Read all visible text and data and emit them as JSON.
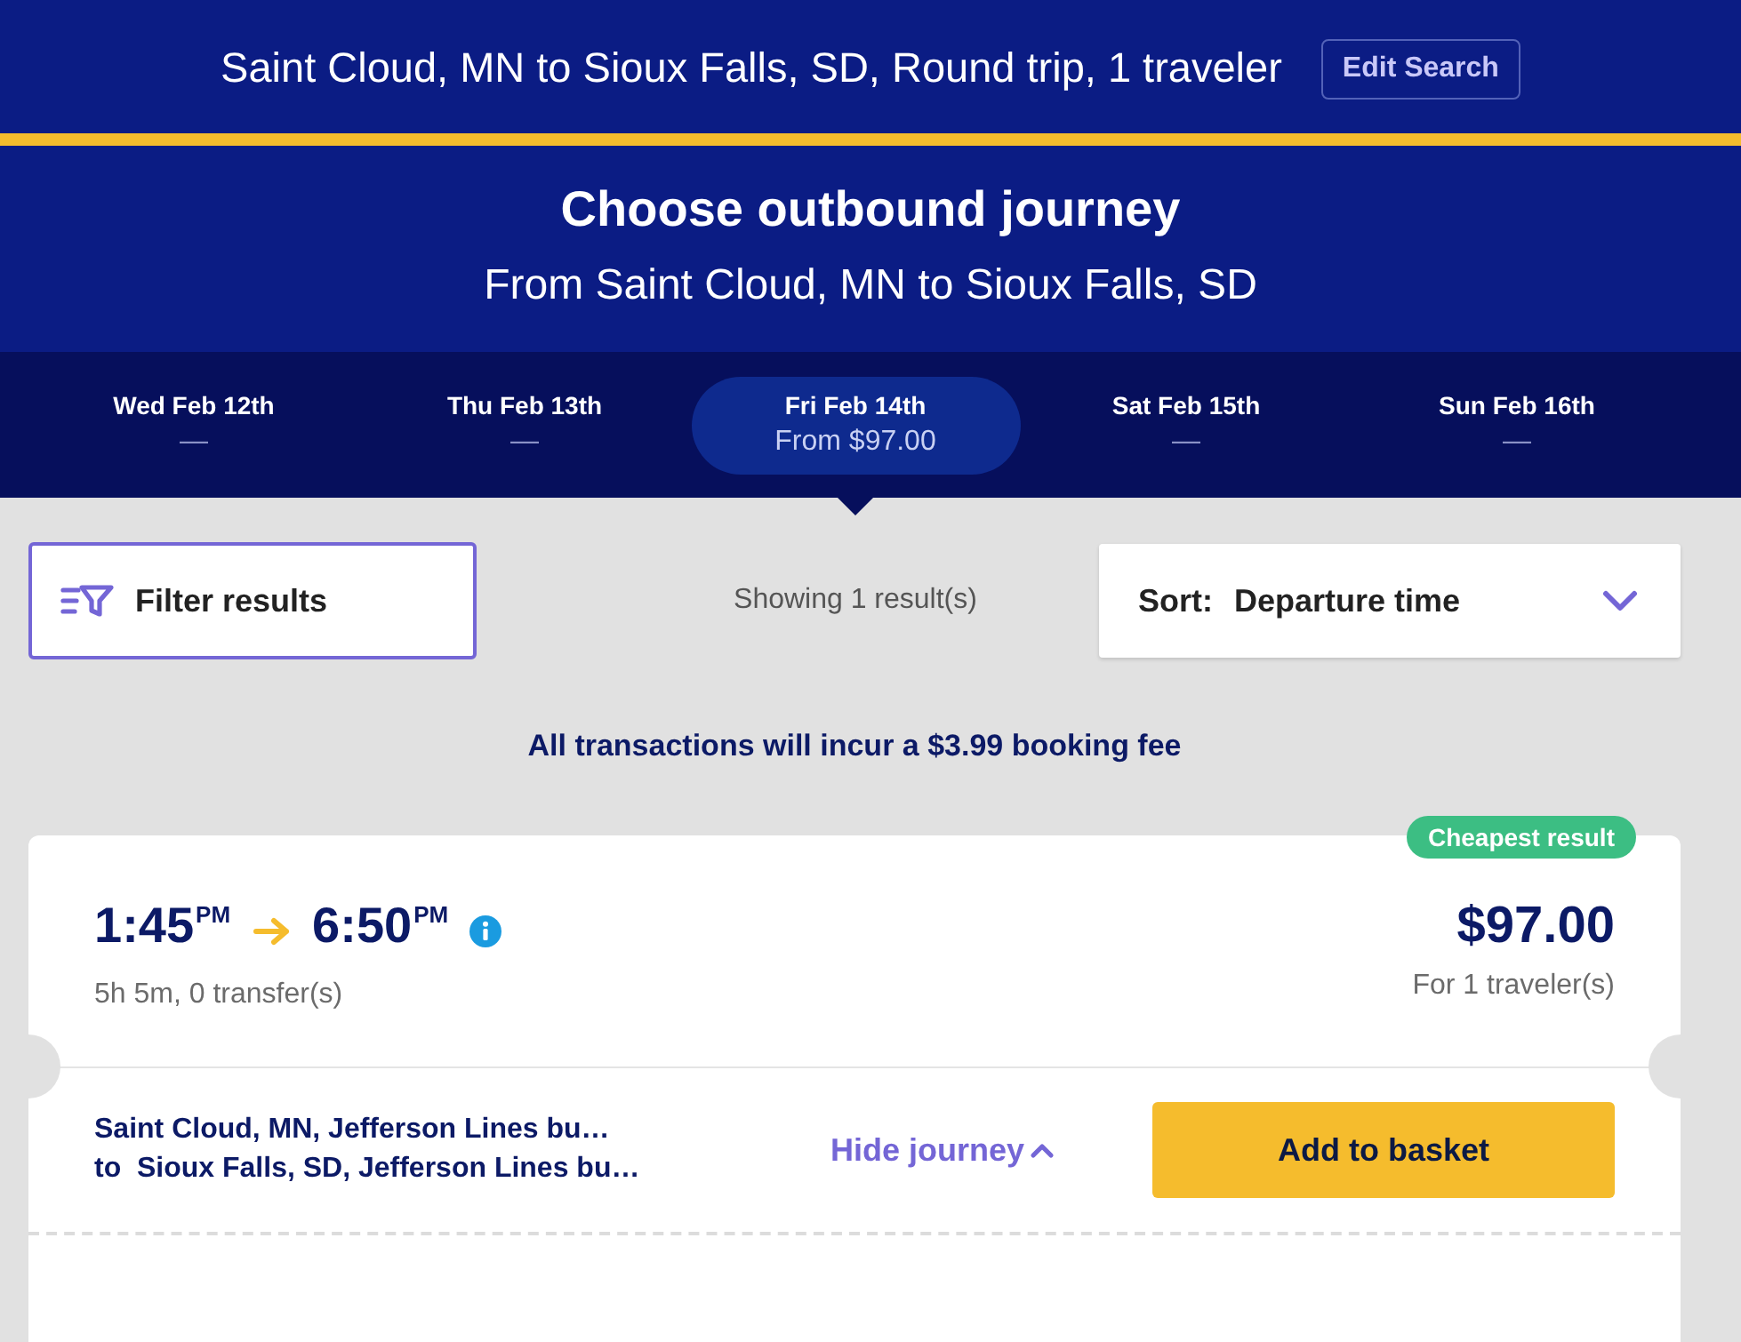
{
  "search_bar": {
    "summary": "Saint Cloud, MN to Sioux Falls, SD, Round trip, 1 traveler",
    "edit_button": "Edit Search"
  },
  "header": {
    "title": "Choose outbound journey",
    "subtitle": "From Saint Cloud, MN to Sioux Falls, SD"
  },
  "date_tabs": [
    {
      "day": "Wed Feb 12th",
      "price": "—",
      "selected": false
    },
    {
      "day": "Thu Feb 13th",
      "price": "—",
      "selected": false
    },
    {
      "day": "Fri Feb 14th",
      "price": "From $97.00",
      "selected": true
    },
    {
      "day": "Sat Feb 15th",
      "price": "—",
      "selected": false
    },
    {
      "day": "Sun Feb 16th",
      "price": "—",
      "selected": false
    }
  ],
  "toolbar": {
    "filter_button": "Filter results",
    "result_count": "Showing 1 result(s)",
    "sort": {
      "label": "Sort:",
      "value": "Departure time"
    }
  },
  "notice": "All transactions will incur a $3.99 booking fee",
  "results": [
    {
      "badge": "Cheapest result",
      "departure": "1:45$^{PM}$",
      "arrival": "6:50$^{PM}$",
      "duration": "5h 5m, 0 transfer(s)",
      "price": "$97.00",
      "price_note": "For 1 traveler(s)",
      "origin": "Saint Cloud, MN, Jefferson Lines bu…",
      "destination": "to  Sioux Falls, SD, Jefferson Lines bu…",
      "toggle": {
        "label": "Hide journey",
        "expanded": true
      },
      "add_button": "Add to basket"
    }
  ]
}
